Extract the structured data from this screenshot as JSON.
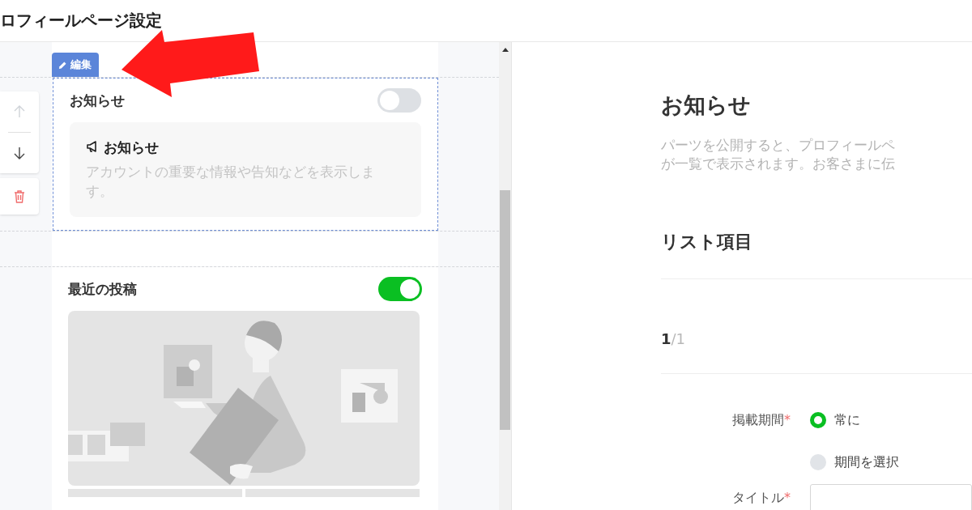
{
  "header": {
    "title": "ロフィールページ設定"
  },
  "side_tools": [
    {
      "kind": "up",
      "disabled": true
    },
    {
      "kind": "down",
      "disabled": false
    },
    {
      "kind": "delete",
      "disabled": false
    }
  ],
  "edit_label": "編集",
  "parts": [
    {
      "kind": "notice",
      "title": "お知らせ",
      "on": false,
      "selected": true,
      "preview_title": "お知らせ",
      "preview_text": "アカウントの重要な情報や告知などを表示します。"
    },
    {
      "kind": "posts",
      "title": "最近の投稿",
      "on": true,
      "selected": false
    }
  ],
  "detail": {
    "title": "お知らせ",
    "description_lines": [
      "パーツを公開すると、プロフィールペ",
      "が一覧で表示されます。お客さまに伝"
    ],
    "section_title": "リスト項目",
    "pager": "**1**/1",
    "fields": [
      {
        "kind": "radio",
        "label": "掲載期間",
        "required_mark": "*",
        "options": [
          {
            "label": "常に",
            "selected": true
          },
          {
            "label": "期間を選択",
            "selected": false
          }
        ]
      },
      {
        "kind": "text",
        "label": "タイトル",
        "required_mark": "*"
      }
    ]
  }
}
